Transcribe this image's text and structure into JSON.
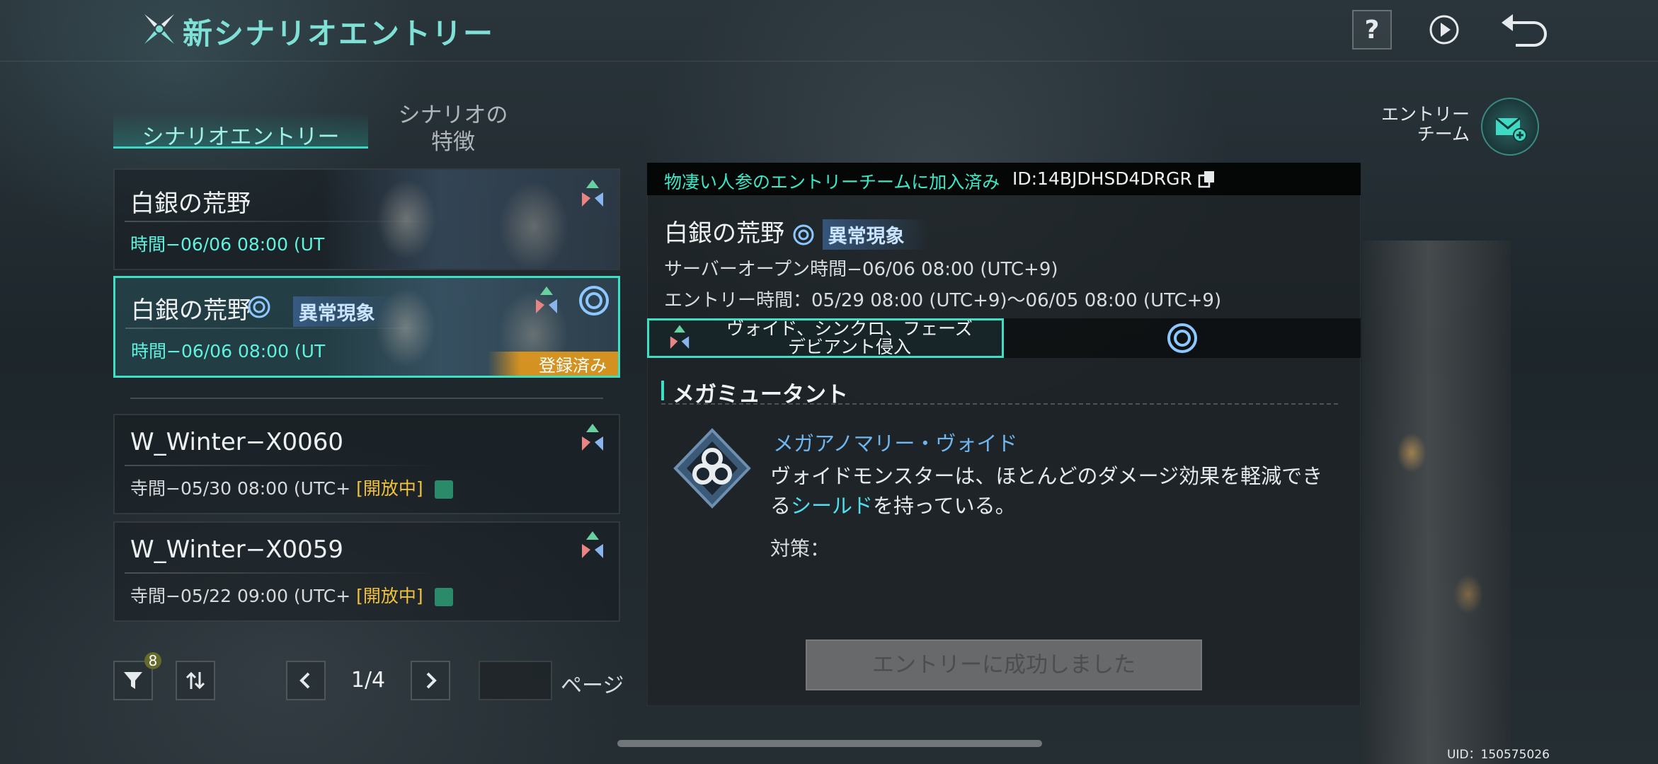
{
  "header": {
    "title": "新シナリオエントリー",
    "help_label": "?"
  },
  "tabs": [
    {
      "label": "シナリオエントリー",
      "active": true
    },
    {
      "label": "シナリオの\n特徴",
      "active": false
    }
  ],
  "scenario_list": [
    {
      "name": "白銀の荒野",
      "time": "時間−06/06 08:00 (UT"
    },
    {
      "name": "白銀の荒野",
      "anomaly_badge": "異常現象",
      "time": "時間−06/06 08:00 (UT",
      "status": "登録済み",
      "selected": true
    },
    {
      "name": "W_Winter−X0060",
      "time": "寺間−05/30 08:00 (UTC+",
      "open_status": "[開放中]"
    },
    {
      "name": "W_Winter−X0059",
      "time": "寺間−05/22 09:00 (UTC+",
      "open_status": "[開放中]"
    }
  ],
  "pager": {
    "filter_count": "8",
    "page_indicator": "1/4",
    "page_label": "ページ"
  },
  "detail": {
    "joined_text": "物凄い人参のエントリーチームに加入済み",
    "team_id": "ID:14BJDHSD4DRGR",
    "name": "白銀の荒野",
    "anomaly_badge": "異常現象",
    "server_open": "サーバーオープン時間−06/06 08:00 (UTC+9)",
    "entry_time": "エントリー時間：05/29 08:00 (UTC+9)〜06/05 08:00 (UTC+9)",
    "trait_line1": "ヴォイド、シンクロ、フェーズ",
    "trait_line2": "デビアント侵入",
    "section_title": "メガミュータント",
    "ability_name": "メガアノマリー・ヴォイド",
    "ability_desc_before": "ヴォイドモンスターは、ほとんどのダメージ効果を軽減できる",
    "ability_desc_term": "シールド",
    "ability_desc_after": "を持っている。",
    "counter_label": "対策：",
    "entry_button": "エントリーに成功しました"
  },
  "side": {
    "entry_team_label": "エントリー\nチーム"
  },
  "uid": "UID：150575026",
  "colors": {
    "accent_teal": "#3ce0c4",
    "open_yellow": "#f0c23a",
    "registered_orange": "#dc961e",
    "ability_blue": "#6fb6f0"
  }
}
